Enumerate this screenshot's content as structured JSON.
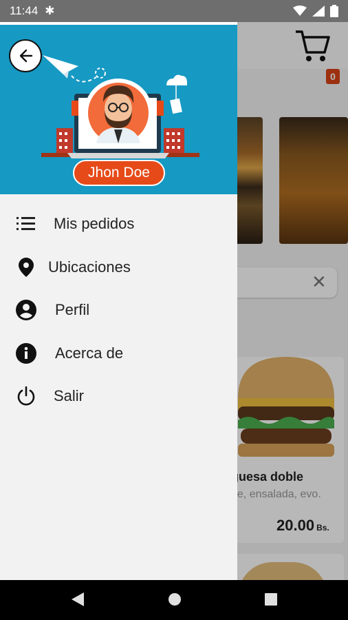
{
  "status_bar": {
    "time": "11:44"
  },
  "background_app": {
    "cart_count": "0",
    "product": {
      "title": "guesa doble",
      "description": "ne, ensalada, evo.",
      "price": "20.00",
      "currency": "Bs."
    }
  },
  "drawer": {
    "user_name": "Jhon Doe",
    "menu": [
      {
        "label": "Mis pedidos",
        "icon": "list-icon"
      },
      {
        "label": "Ubicaciones",
        "icon": "location-pin-icon"
      },
      {
        "label": "Perfil",
        "icon": "account-circle-icon"
      },
      {
        "label": "Acerca de",
        "icon": "info-icon"
      },
      {
        "label": "Salir",
        "icon": "power-icon"
      }
    ]
  },
  "colors": {
    "header": "#1699c3",
    "accent": "#e64a19",
    "drawer_bg": "#f2f2f2"
  }
}
